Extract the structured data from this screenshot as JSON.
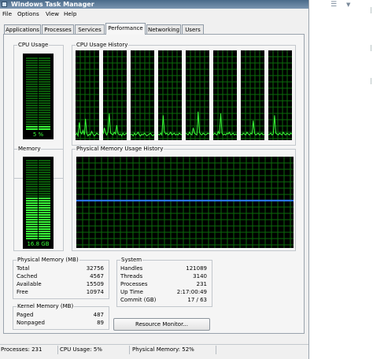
{
  "window": {
    "title": "Windows Task Manager"
  },
  "menu": [
    "File",
    "Options",
    "View",
    "Help"
  ],
  "tabs": [
    {
      "label": "Applications",
      "active": false
    },
    {
      "label": "Processes",
      "active": false
    },
    {
      "label": "Services",
      "active": false
    },
    {
      "label": "Performance",
      "active": true
    },
    {
      "label": "Networking",
      "active": false
    },
    {
      "label": "Users",
      "active": false
    }
  ],
  "cpu_usage": {
    "label": "CPU Usage",
    "value_text": "5 %",
    "percent": 5
  },
  "cpu_history": {
    "label": "CPU Usage History",
    "cores": 8,
    "traces": [
      [
        4,
        6,
        3,
        18,
        7,
        5,
        9,
        4,
        22,
        6,
        3,
        5,
        4,
        8,
        5,
        3,
        4,
        6,
        5,
        4
      ],
      [
        5,
        12,
        6,
        4,
        8,
        28,
        6,
        5,
        4,
        7,
        5,
        15,
        6,
        4,
        5,
        3,
        6,
        4,
        5,
        6
      ],
      [
        4,
        5,
        3,
        6,
        4,
        5,
        7,
        4,
        3,
        5,
        4,
        6,
        5,
        3,
        4,
        5,
        6,
        4,
        3,
        5
      ],
      [
        5,
        4,
        6,
        4,
        26,
        8,
        5,
        6,
        4,
        5,
        7,
        4,
        5,
        6,
        4,
        5,
        4,
        6,
        5,
        4
      ],
      [
        6,
        5,
        4,
        7,
        5,
        4,
        12,
        6,
        5,
        4,
        30,
        7,
        5,
        4,
        6,
        5,
        4,
        5,
        6,
        5
      ],
      [
        4,
        6,
        5,
        4,
        8,
        5,
        28,
        6,
        4,
        5,
        4,
        6,
        5,
        7,
        4,
        5,
        6,
        4,
        5,
        4
      ],
      [
        5,
        4,
        6,
        5,
        4,
        7,
        5,
        4,
        6,
        5,
        20,
        6,
        4,
        5,
        6,
        4,
        5,
        6,
        4,
        5
      ],
      [
        4,
        5,
        6,
        4,
        5,
        26,
        6,
        5,
        4,
        6,
        5,
        4,
        7,
        5,
        4,
        6,
        5,
        4,
        6,
        5
      ]
    ]
  },
  "memory": {
    "label": "Memory",
    "value_text": "16.8 GB",
    "percent": 52
  },
  "memory_history": {
    "label": "Physical Memory Usage History",
    "percent": 52
  },
  "physical_memory": {
    "label": "Physical Memory (MB)",
    "rows": [
      {
        "name": "Total",
        "value": "32756"
      },
      {
        "name": "Cached",
        "value": "4567"
      },
      {
        "name": "Available",
        "value": "15509"
      },
      {
        "name": "Free",
        "value": "10974"
      }
    ]
  },
  "system": {
    "label": "System",
    "rows": [
      {
        "name": "Handles",
        "value": "121089"
      },
      {
        "name": "Threads",
        "value": "3140"
      },
      {
        "name": "Processes",
        "value": "231"
      },
      {
        "name": "Up Time",
        "value": "2:17:00:49"
      },
      {
        "name": "Commit (GB)",
        "value": "17 / 63"
      }
    ]
  },
  "kernel_memory": {
    "label": "Kernel Memory (MB)",
    "rows": [
      {
        "name": "Paged",
        "value": "487"
      },
      {
        "name": "Nonpaged",
        "value": "89"
      }
    ]
  },
  "resource_monitor_button": "Resource Monitor...",
  "statusbar": {
    "processes": "Processes: 231",
    "cpu": "CPU Usage: 5%",
    "memory": "Physical Memory: 52%"
  },
  "colors": {
    "meter_on": "#39ff39",
    "meter_off": "#0b5a0b",
    "grid_line": "#0b6b0b",
    "memory_line": "#2f7fff"
  }
}
